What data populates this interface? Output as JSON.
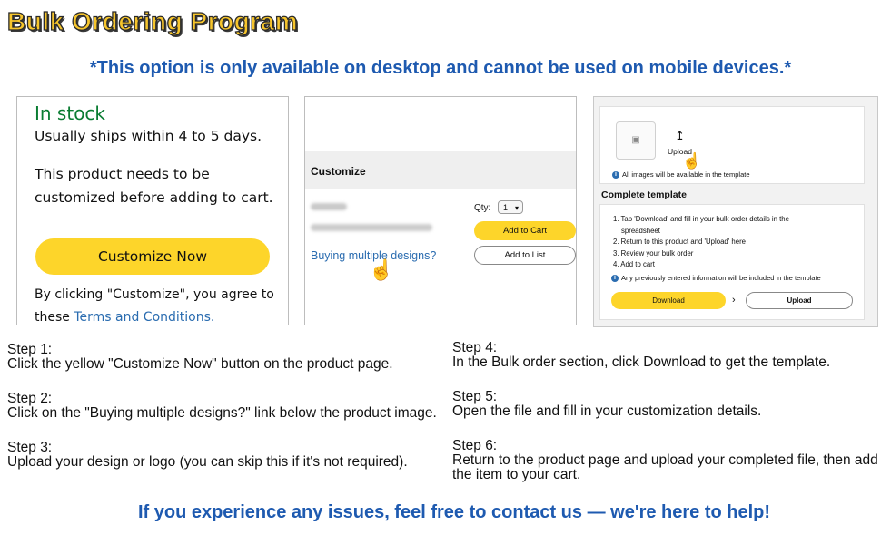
{
  "title": "Bulk Ordering Program",
  "notice": "*This option is only available on desktop and cannot be used on mobile devices.*",
  "panel1": {
    "stock": "In stock",
    "ships": "Usually ships within 4 to 5 days.",
    "needs": "This product needs to be customized before adding to cart.",
    "button": "Customize Now",
    "agree_prefix": "By clicking \"Customize\", you agree to these ",
    "terms": "Terms and Conditions."
  },
  "panel2": {
    "section": "Customize",
    "qty_label": "Qty:",
    "qty_value": "1",
    "add_to_cart": "Add to Cart",
    "add_to_list": "Add to List",
    "multi_link": "Buying multiple designs?"
  },
  "panel3": {
    "upload_label": "Upload",
    "images_note": "All images will be available in the template",
    "complete_title": "Complete template",
    "steps": [
      "1. Tap 'Download' and fill in your bulk order details in the",
      "    spreadsheet",
      "2. Return to this product and 'Upload' here",
      "3. Review your bulk order",
      "4. Add to cart"
    ],
    "info_note": "Any previously entered information will be included in the template",
    "download": "Download",
    "upload": "Upload"
  },
  "steps": [
    {
      "title": "Step 1:",
      "desc": "Click the yellow \"Customize Now\" button on the product page."
    },
    {
      "title": "Step 2:",
      "desc": "Click on the \"Buying multiple designs?\" link below the product image."
    },
    {
      "title": "Step 3:",
      "desc": "Upload your design or logo (you can skip this if it's not required)."
    },
    {
      "title": "Step 4:",
      "desc": "In the Bulk order section, click Download to get the template."
    },
    {
      "title": "Step 5:",
      "desc": "Open the file and fill in your customization details."
    },
    {
      "title": "Step 6:",
      "desc": "Return to the product page and upload your completed file, then add the item to your cart."
    }
  ],
  "footer": "If you experience any issues, feel free to contact us — we're here to help!",
  "colors": {
    "accent_yellow": "#fdd52a",
    "link_blue": "#2a6cb0",
    "heading_blue": "#1e5ab0",
    "stock_green": "#0a7c32"
  }
}
